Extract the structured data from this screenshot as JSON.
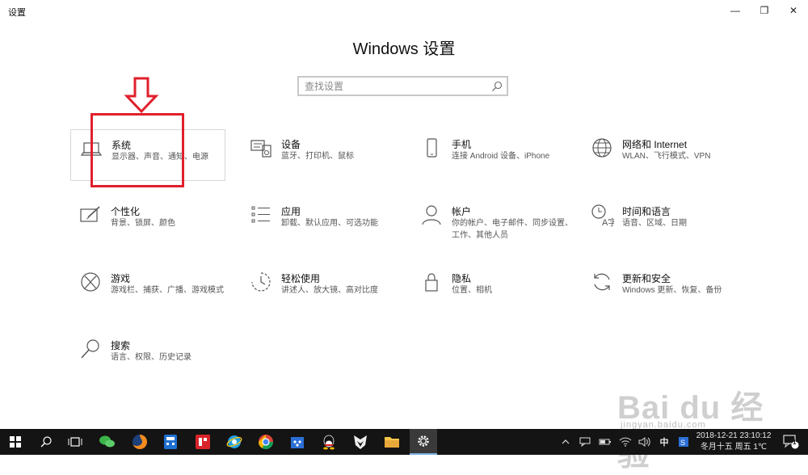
{
  "window": {
    "title": "设置",
    "controls": {
      "minimize": "—",
      "maximize": "❐",
      "close": "✕"
    }
  },
  "page": {
    "title": "Windows 设置"
  },
  "search": {
    "placeholder": "查找设置"
  },
  "tiles": [
    {
      "title": "系统",
      "desc": "显示器、声音、通知、电源",
      "icon": "laptop-icon"
    },
    {
      "title": "设备",
      "desc": "蓝牙、打印机、鼠标",
      "icon": "keyboard-printer-icon"
    },
    {
      "title": "手机",
      "desc": "连接 Android 设备、iPhone",
      "icon": "phone-icon"
    },
    {
      "title": "网络和 Internet",
      "desc": "WLAN、飞行模式、VPN",
      "icon": "globe-icon"
    },
    {
      "title": "个性化",
      "desc": "背景、锁屏、颜色",
      "icon": "paint-brush-icon"
    },
    {
      "title": "应用",
      "desc": "卸载、默认应用、可选功能",
      "icon": "apps-list-icon"
    },
    {
      "title": "帐户",
      "desc": "你的帐户、电子邮件、同步设置、工作、其他人员",
      "icon": "person-icon"
    },
    {
      "title": "时间和语言",
      "desc": "语音、区域、日期",
      "icon": "time-language-icon"
    },
    {
      "title": "游戏",
      "desc": "游戏栏、捕获、广播、游戏模式",
      "icon": "xbox-icon"
    },
    {
      "title": "轻松使用",
      "desc": "讲述人、放大镜、高对比度",
      "icon": "ease-of-access-icon"
    },
    {
      "title": "隐私",
      "desc": "位置、相机",
      "icon": "lock-icon"
    },
    {
      "title": "更新和安全",
      "desc": "Windows 更新、恢复、备份",
      "icon": "refresh-icon"
    },
    {
      "title": "搜索",
      "desc": "语言、权限、历史记录",
      "icon": "search-icon"
    }
  ],
  "watermark": {
    "main": "Bai du 经验",
    "sub": "jingyan.baidu.com"
  },
  "taskbar": {
    "apps": [
      "start-icon",
      "search-icon",
      "task-view-icon",
      "wechat-icon",
      "firefox-icon",
      "calculator-icon",
      "app-red-icon",
      "ie-icon",
      "chrome-icon",
      "store-icon",
      "qq-icon",
      "foxit-icon",
      "file-explorer-icon",
      "settings-icon"
    ],
    "tray": {
      "ime": "中",
      "date": "2018-12-21",
      "time": "23:10:12",
      "lunar": "冬月十五 周五 1℃",
      "notification_count": "1"
    }
  },
  "colors": {
    "annotation": "#e0202c",
    "taskbar": "#141414",
    "accent": "#7ab0e0"
  }
}
